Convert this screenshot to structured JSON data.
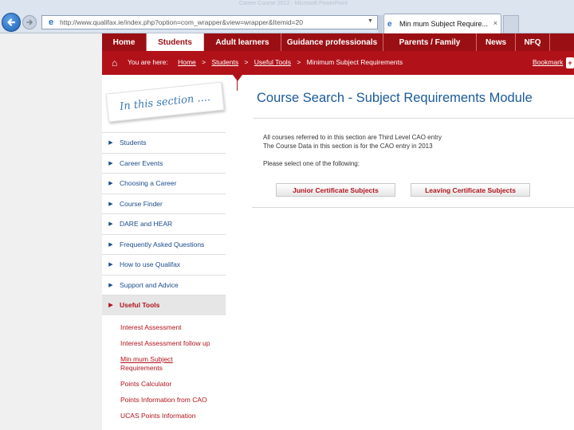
{
  "browser": {
    "title_text": "Career Course 2012 - Microsoft PowerPoint",
    "url": "http://www.qualifax.ie/index.php?option=com_wrapper&view=wrapper&Itemid=20",
    "tab_label": "Min mum Subject Require...",
    "tab_close": "×"
  },
  "nav": {
    "items": [
      "Home",
      "Students",
      "Adult learners",
      "Guidance professionals",
      "Parents / Family",
      "News",
      "NFQ"
    ],
    "active": "Students"
  },
  "breadcrumb": {
    "prefix": "You are here:",
    "items": [
      "Home",
      "Students",
      "Useful Tools",
      "Minimum Subject Requirements"
    ],
    "separator": ">",
    "bookmark": "Bookmark"
  },
  "sidebar": {
    "heading": "In this section ....",
    "items": [
      "Students",
      "Career Events",
      "Choosing a Career",
      "Course Finder",
      "DARE and HEAR",
      "Frequently Asked Questions",
      "How to use Qualifax",
      "Support and Advice",
      "Useful Tools"
    ],
    "active": "Useful Tools",
    "sub_items": [
      "Interest Assessment",
      "Interest Assessment follow up",
      "Min mum Subject",
      "Requirements",
      "Points Calculator",
      "Points Information from CAO",
      "UCAS Points Information"
    ]
  },
  "main": {
    "title": "Course Search - Subject Requirements Module",
    "intro_line1": "All courses referred to in this section are Third Level CAO entry",
    "intro_line2": "The Course Data in this section is for the CAO entry in 2013",
    "prompt": "Please select one of the following:",
    "junior_button": "Junior Certificate Subjects",
    "leaving_button": "Leaving Certificate Subjects"
  },
  "colors": {
    "brand_red": "#9a0f14",
    "crumb_red": "#b1121a",
    "link_blue": "#1a4a8c",
    "title_blue": "#1a5a9c"
  },
  "icons": [
    "back-arrow-icon",
    "forward-arrow-icon",
    "ie-page-icon",
    "home-icon",
    "share-icon"
  ]
}
